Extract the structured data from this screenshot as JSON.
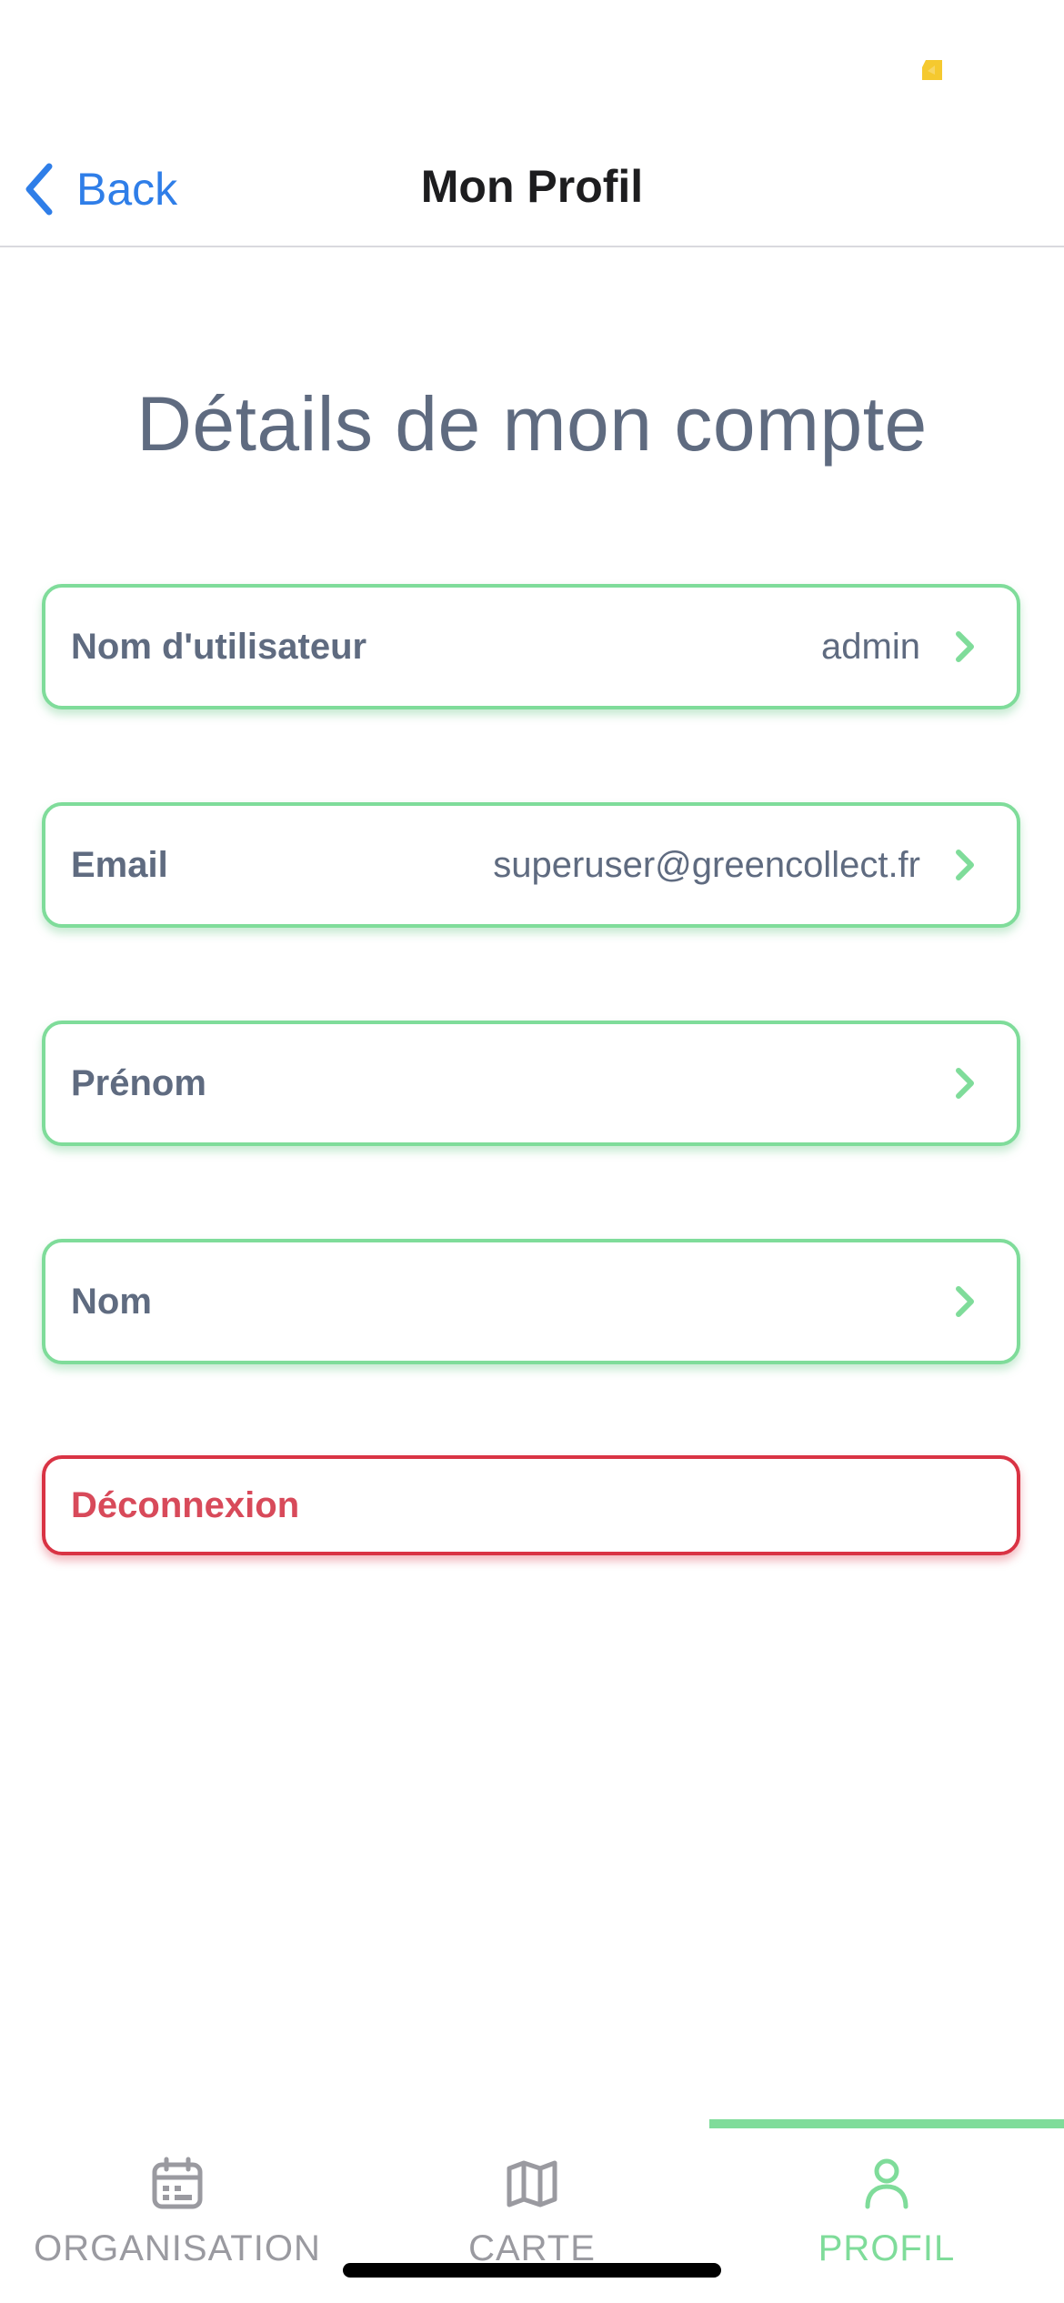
{
  "status_bar": {
    "indicator_color": "#f5c92f"
  },
  "navbar": {
    "back_label": "Back",
    "title": "Mon Profil"
  },
  "main": {
    "heading": "Détails de mon compte",
    "fields": [
      {
        "label": "Nom d'utilisateur",
        "value": "admin"
      },
      {
        "label": "Email",
        "value": "superuser@greencollect.fr"
      },
      {
        "label": "Prénom",
        "value": ""
      },
      {
        "label": "Nom",
        "value": ""
      }
    ],
    "logout_label": "Déconnexion"
  },
  "tabbar": {
    "tabs": [
      {
        "label": "ORGANISATION",
        "icon": "calendar-icon",
        "active": false
      },
      {
        "label": "CARTE",
        "icon": "map-icon",
        "active": false
      },
      {
        "label": "PROFIL",
        "icon": "user-icon",
        "active": true
      }
    ]
  },
  "colors": {
    "accent_green": "#7fdc9a",
    "danger_red": "#d93344",
    "link_blue": "#2f7ee8",
    "text_gray": "#5f6b80"
  }
}
